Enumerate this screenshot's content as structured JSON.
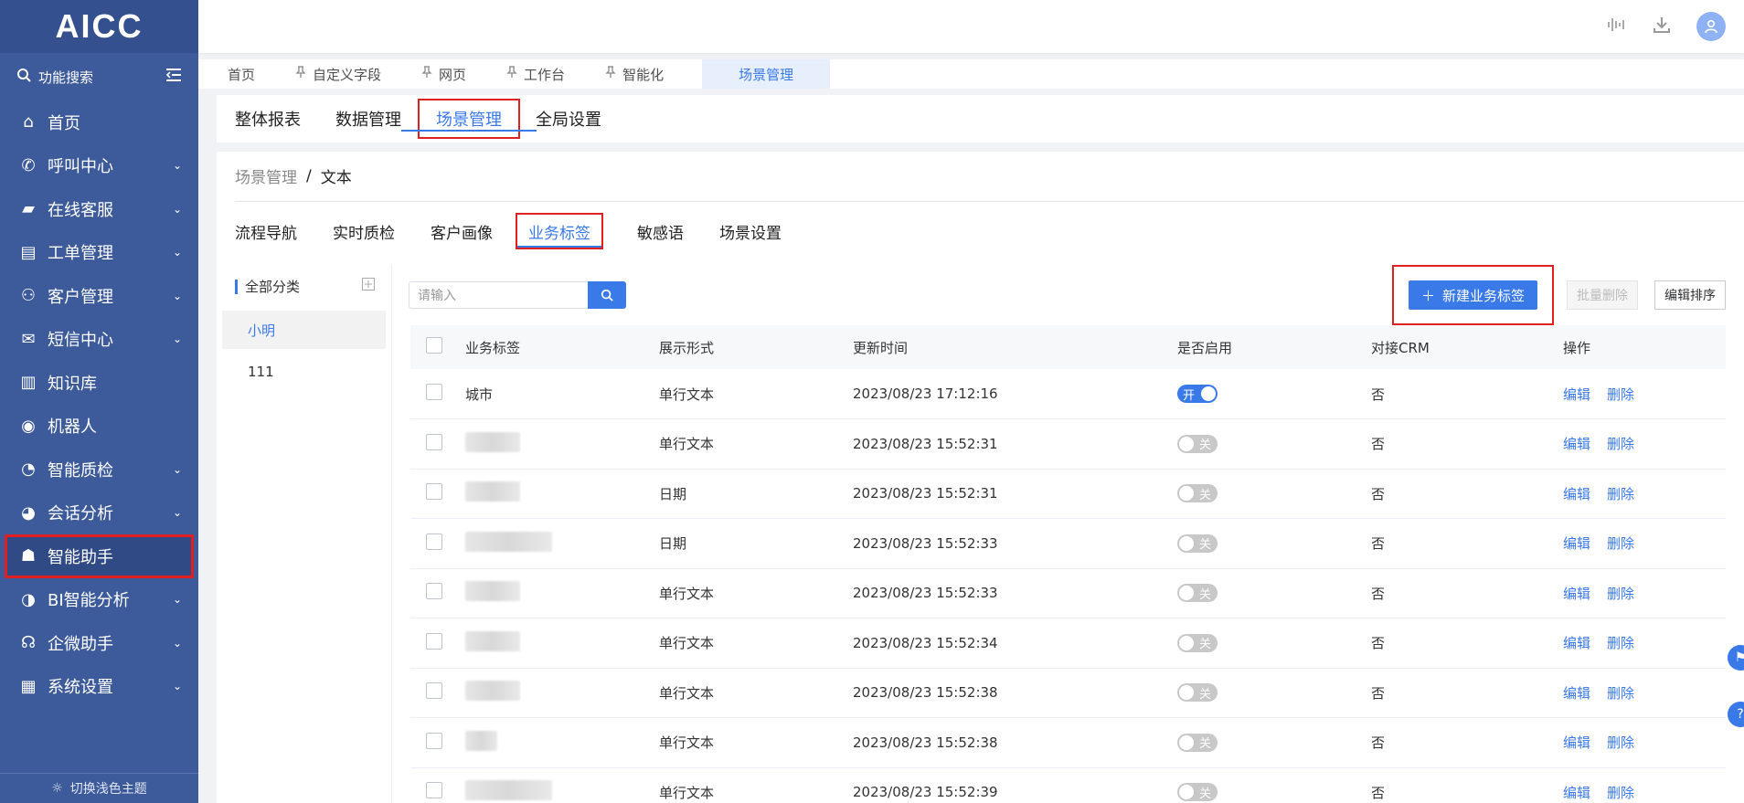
{
  "app": {
    "logo": "AICC"
  },
  "sidebar": {
    "search_label": "功能搜索",
    "items": [
      {
        "label": "首页",
        "icon": "home-icon",
        "chevron": false
      },
      {
        "label": "呼叫中心",
        "icon": "phone-icon",
        "chevron": true
      },
      {
        "label": "在线客服",
        "icon": "chat-icon",
        "chevron": true
      },
      {
        "label": "工单管理",
        "icon": "clipboard-icon",
        "chevron": true
      },
      {
        "label": "客户管理",
        "icon": "users-icon",
        "chevron": true
      },
      {
        "label": "短信中心",
        "icon": "mail-icon",
        "chevron": true
      },
      {
        "label": "知识库",
        "icon": "library-icon",
        "chevron": false
      },
      {
        "label": "机器人",
        "icon": "robot-icon",
        "chevron": false
      },
      {
        "label": "智能质检",
        "icon": "inspect-icon",
        "chevron": true
      },
      {
        "label": "会话分析",
        "icon": "conversation-icon",
        "chevron": true
      },
      {
        "label": "智能助手",
        "icon": "assistant-icon",
        "chevron": false
      },
      {
        "label": "BI智能分析",
        "icon": "pie-chart-icon",
        "chevron": true
      },
      {
        "label": "企微助手",
        "icon": "wecom-icon",
        "chevron": true
      },
      {
        "label": "系统设置",
        "icon": "grid-icon",
        "chevron": true
      }
    ],
    "theme_switch": "切换浅色主题"
  },
  "tabs_bar": {
    "tabs": [
      {
        "label": "首页",
        "pinned": false
      },
      {
        "label": "自定义字段",
        "pinned": true
      },
      {
        "label": "网页",
        "pinned": true
      },
      {
        "label": "工作台",
        "pinned": true
      },
      {
        "label": "智能化",
        "pinned": true
      },
      {
        "label": "场景管理",
        "pinned": false,
        "active": true
      }
    ]
  },
  "module_tabs": [
    "整体报表",
    "数据管理",
    "场景管理",
    "全局设置"
  ],
  "breadcrumb": {
    "parent": "场景管理",
    "separator": "/",
    "current": "文本"
  },
  "sub_tabs": [
    "流程导航",
    "实时质检",
    "客户画像",
    "业务标签",
    "敏感语",
    "场景设置"
  ],
  "category_panel": {
    "title": "全部分类",
    "items": [
      {
        "label": "小明",
        "active": true
      },
      {
        "label": "111",
        "active": false
      }
    ]
  },
  "toolbar": {
    "search_placeholder": "请输入",
    "new_button": "新建业务标签",
    "batch_delete": "批量删除",
    "edit_sort": "编辑排序"
  },
  "table": {
    "columns": [
      "业务标签",
      "展示形式",
      "更新时间",
      "是否启用",
      "对接CRM",
      "操作"
    ],
    "rows": [
      {
        "tag": "城市",
        "form": "单行文本",
        "time": "2023/08/23 17:12:16",
        "enabled": true,
        "crm": "否"
      },
      {
        "tag": "",
        "form": "单行文本",
        "time": "2023/08/23 15:52:31",
        "enabled": false,
        "crm": "否"
      },
      {
        "tag": "",
        "form": "日期",
        "time": "2023/08/23 15:52:31",
        "enabled": false,
        "crm": "否"
      },
      {
        "tag": "",
        "form": "日期",
        "time": "2023/08/23 15:52:33",
        "enabled": false,
        "crm": "否"
      },
      {
        "tag": "",
        "form": "单行文本",
        "time": "2023/08/23 15:52:33",
        "enabled": false,
        "crm": "否"
      },
      {
        "tag": "",
        "form": "单行文本",
        "time": "2023/08/23 15:52:34",
        "enabled": false,
        "crm": "否"
      },
      {
        "tag": "",
        "form": "单行文本",
        "time": "2023/08/23 15:52:38",
        "enabled": false,
        "crm": "否"
      },
      {
        "tag": "",
        "form": "单行文本",
        "time": "2023/08/23 15:52:38",
        "enabled": false,
        "crm": "否"
      },
      {
        "tag": "",
        "form": "单行文本",
        "time": "2023/08/23 15:52:39",
        "enabled": false,
        "crm": "否"
      }
    ],
    "toggle_on": "开",
    "toggle_off": "关",
    "edit": "编辑",
    "delete": "删除"
  },
  "colors": {
    "sidebar": "#3d5a9a",
    "accent": "#3a79e8",
    "highlight": "#e02020"
  }
}
